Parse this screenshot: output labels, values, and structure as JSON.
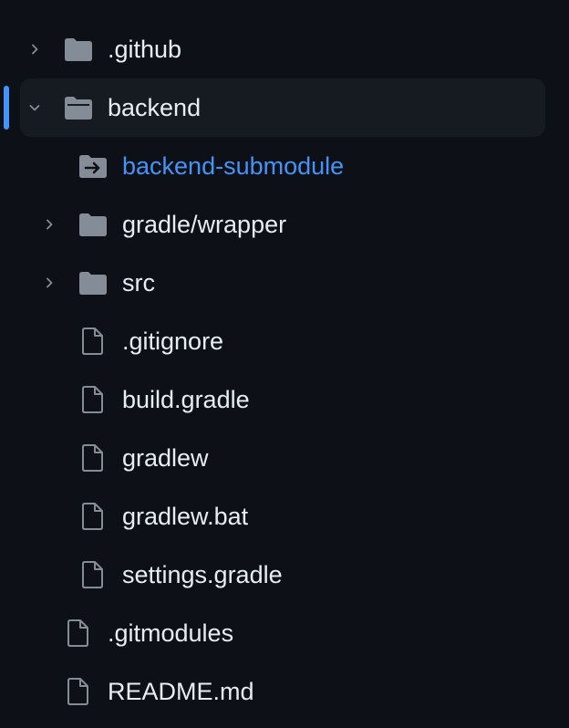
{
  "colors": {
    "background": "#0d1117",
    "selected_row": "#161b22",
    "accent": "#4493f8",
    "text": "#e6edf3",
    "icon": "#848d97"
  },
  "tree": {
    "items": [
      {
        "label": ".github",
        "type": "folder",
        "state": "collapsed",
        "icon": "folder-icon"
      },
      {
        "label": "backend",
        "type": "folder",
        "state": "expanded",
        "selected": true,
        "icon": "folder-open-icon"
      },
      {
        "label": "backend-submodule",
        "type": "submodule",
        "icon": "submodule-icon"
      },
      {
        "label": "gradle/wrapper",
        "type": "folder",
        "state": "collapsed",
        "icon": "folder-icon"
      },
      {
        "label": "src",
        "type": "folder",
        "state": "collapsed",
        "icon": "folder-icon"
      },
      {
        "label": ".gitignore",
        "type": "file",
        "icon": "file-icon"
      },
      {
        "label": "build.gradle",
        "type": "file",
        "icon": "file-icon"
      },
      {
        "label": "gradlew",
        "type": "file",
        "icon": "file-icon"
      },
      {
        "label": "gradlew.bat",
        "type": "file",
        "icon": "file-icon"
      },
      {
        "label": "settings.gradle",
        "type": "file",
        "icon": "file-icon"
      },
      {
        "label": ".gitmodules",
        "type": "file",
        "icon": "file-icon"
      },
      {
        "label": "README.md",
        "type": "file",
        "icon": "file-icon"
      }
    ]
  }
}
